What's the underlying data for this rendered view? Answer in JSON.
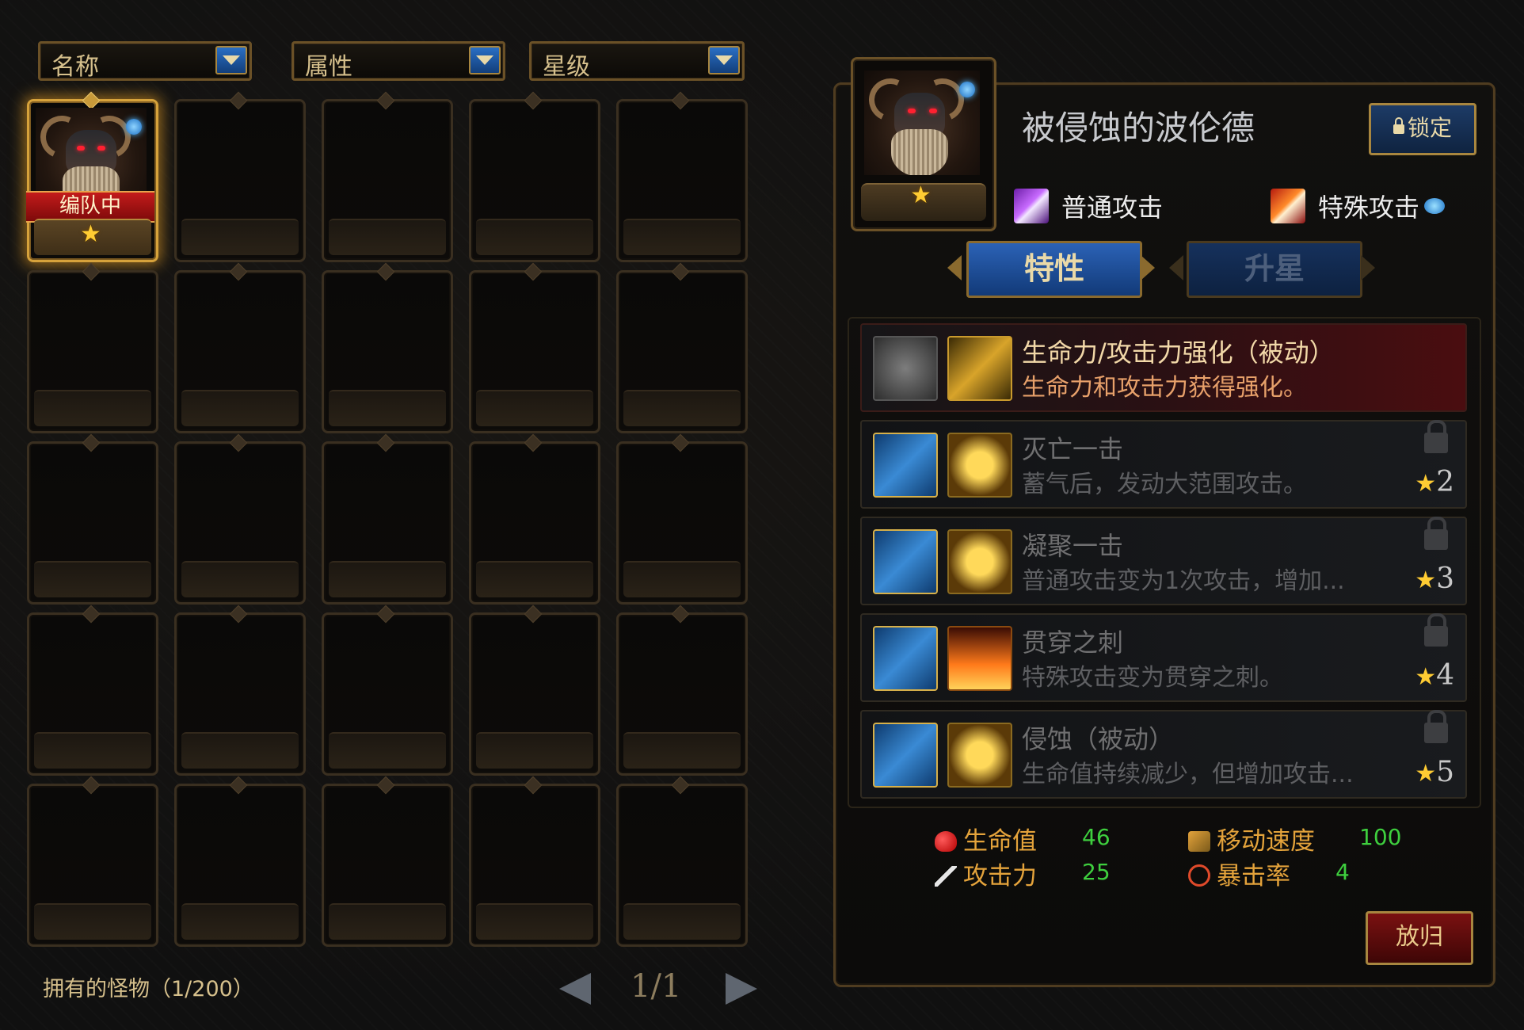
{
  "filters": {
    "name_label": "名称",
    "attribute_label": "属性",
    "star_label": "星级"
  },
  "grid": {
    "columns": 5,
    "rows": 5,
    "owned_monster": {
      "badge": "编队中",
      "star_icon": "star-icon"
    }
  },
  "footer": {
    "owned_count": "拥有的怪物（1/200）",
    "page": "1/1"
  },
  "detail": {
    "name": "被侵蚀的波伦德",
    "lock_label": "锁定",
    "normal_attack": "普通攻击",
    "special_attack": "特殊攻击",
    "tabs": {
      "traits": "特性",
      "star_up": "升星"
    },
    "traits": [
      {
        "name": "生命力/攻击力强化（被动）",
        "desc": "生命力和攻击力获得强化。",
        "active": true,
        "req": ""
      },
      {
        "name": "灭亡一击",
        "desc": "蓄气后，发动大范围攻击。",
        "active": false,
        "req": "2"
      },
      {
        "name": "凝聚一击",
        "desc": "普通攻击变为1次攻击，增加...",
        "active": false,
        "req": "3"
      },
      {
        "name": "贯穿之刺",
        "desc": "特殊攻击变为贯穿之刺。",
        "active": false,
        "req": "4"
      },
      {
        "name": "侵蚀（被动）",
        "desc": "生命值持续减少，但增加攻击...",
        "active": false,
        "req": "5"
      }
    ],
    "stats": {
      "hp_label": "生命值",
      "hp_value": "46",
      "atk_label": "攻击力",
      "atk_value": "25",
      "speed_label": "移动速度",
      "speed_value": "100",
      "crit_label": "暴击率",
      "crit_value": "4"
    },
    "release_label": "放归"
  },
  "colors": {
    "gold": "#d6a23b",
    "active_tab": "#2b62b6",
    "stat_label": "#e4a33b",
    "stat_value": "#3ecf3e",
    "release": "#7a1111"
  }
}
